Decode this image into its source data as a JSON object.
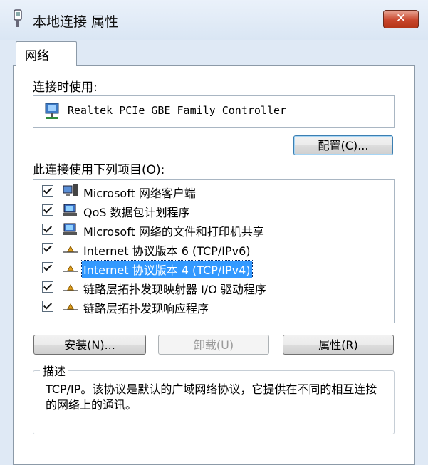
{
  "window": {
    "title": "本地连接 属性",
    "close_label": "✕"
  },
  "tab": {
    "label": "网络"
  },
  "connect_using": {
    "label": "连接时使用:",
    "adapter_name": "Realtek PCIe GBE Family Controller"
  },
  "buttons": {
    "configure": "配置(C)...",
    "install": "安装(N)...",
    "uninstall": "卸载(U)",
    "properties": "属性(R)"
  },
  "items_label": "此连接使用下列项目(O):",
  "items": [
    {
      "label": "Microsoft 网络客户端",
      "checked": true,
      "icon": "network-client-icon"
    },
    {
      "label": "QoS 数据包计划程序",
      "checked": true,
      "icon": "qos-scheduler-icon"
    },
    {
      "label": "Microsoft 网络的文件和打印机共享",
      "checked": true,
      "icon": "file-printer-sharing-icon"
    },
    {
      "label": "Internet 协议版本 6 (TCP/IPv6)",
      "checked": true,
      "icon": "protocol-icon"
    },
    {
      "label": "Internet 协议版本 4 (TCP/IPv4)",
      "checked": true,
      "icon": "protocol-icon",
      "selected": true
    },
    {
      "label": "链路层拓扑发现映射器 I/O 驱动程序",
      "checked": true,
      "icon": "protocol-icon"
    },
    {
      "label": "链路层拓扑发现响应程序",
      "checked": true,
      "icon": "protocol-icon"
    }
  ],
  "description": {
    "title": "描述",
    "text": "TCP/IP。该协议是默认的广域网络协议，它提供在不同的相互连接的网络上的通讯。"
  },
  "colors": {
    "selection": "#3399ff",
    "close_button": "#c9462c",
    "window_frame": "#dfe9f5"
  }
}
